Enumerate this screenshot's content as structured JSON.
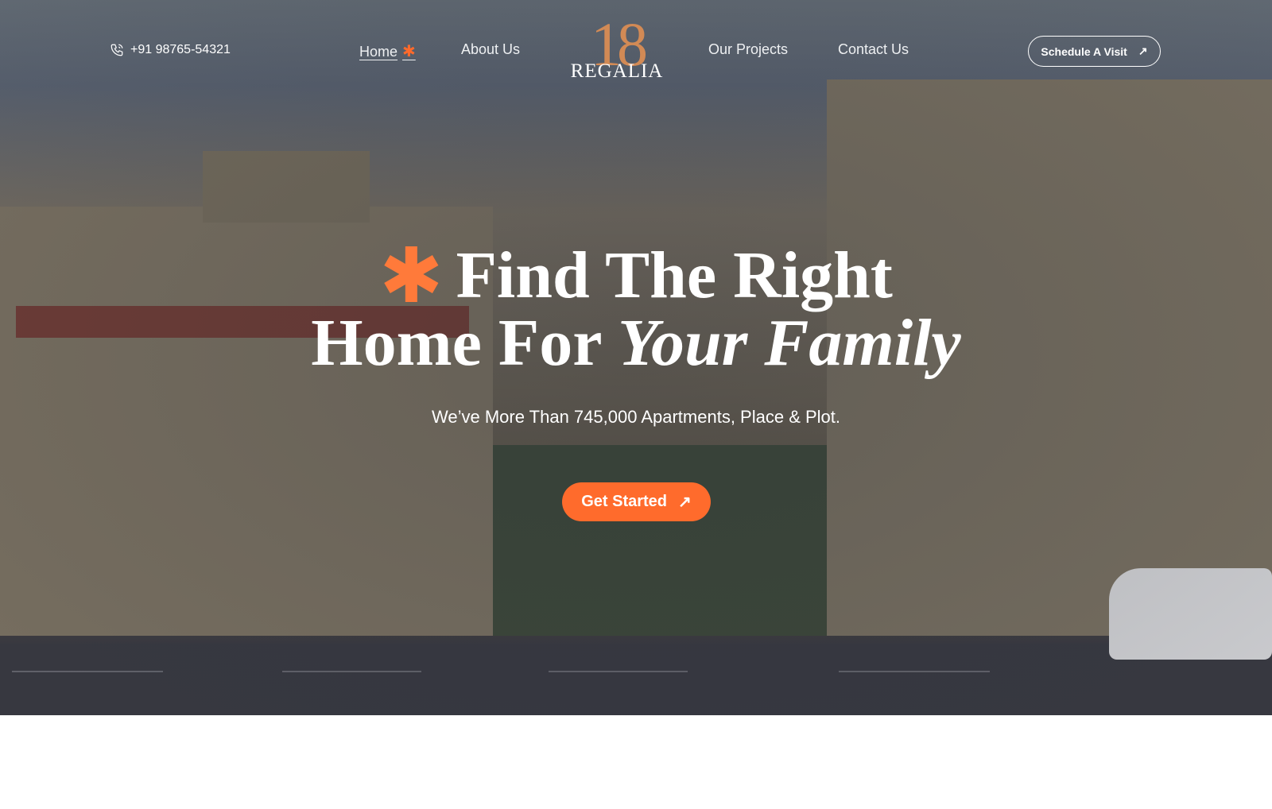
{
  "header": {
    "phone": "+91 98765-54321",
    "nav": [
      {
        "label": "Home",
        "active": true
      },
      {
        "label": "About Us"
      },
      {
        "label": "Our Projects"
      },
      {
        "label": "Contact Us"
      }
    ],
    "logo": {
      "number": "18",
      "word": "REGALIA"
    },
    "schedule_label": "Schedule A Visit"
  },
  "hero": {
    "title_line1": "Find The Right",
    "title_line2_plain": "Home For",
    "title_line2_italic": "Your Family",
    "subtitle": "We’ve More Than 745,000 Apartments, Place & Plot.",
    "cta_label": "Get Started"
  },
  "colors": {
    "accent": "#ff6b2c",
    "logo_gold": "#d28a55"
  }
}
